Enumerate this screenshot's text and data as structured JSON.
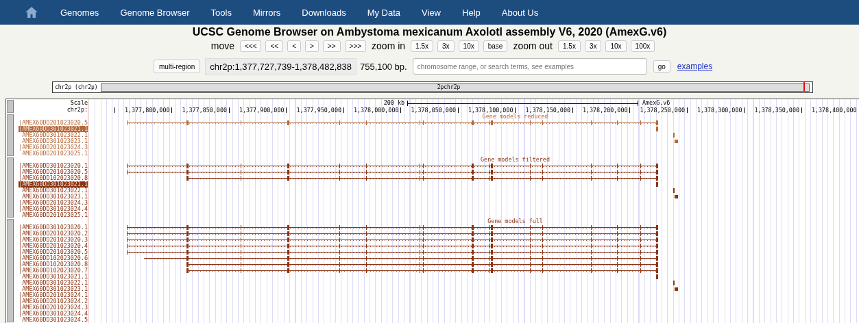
{
  "nav": [
    "Genomes",
    "Genome Browser",
    "Tools",
    "Mirrors",
    "Downloads",
    "My Data",
    "View",
    "Help",
    "About Us"
  ],
  "title": "UCSC Genome Browser on Ambystoma mexicanum Axolotl assembly V6, 2020 (AmexG.v6)",
  "move": {
    "label": "move",
    "buttons": [
      "<<<",
      "<<",
      "<",
      ">",
      ">>",
      ">>>"
    ]
  },
  "zoom_in": {
    "label": "zoom in",
    "buttons": [
      "1.5x",
      "3x",
      "10x",
      "base"
    ]
  },
  "zoom_out": {
    "label": "zoom out",
    "buttons": [
      "1.5x",
      "3x",
      "10x",
      "100x"
    ]
  },
  "position": {
    "multi_region": "multi-region",
    "value": "chr2p:1,377,727,739-1,378,482,838",
    "size": "755,100 bp.",
    "placeholder": "chromosome range, or search terms, see examples",
    "go": "go",
    "examples": "examples"
  },
  "ideogram": {
    "label": "chr2p (chr2p)",
    "band": "2pchr2p",
    "level": 0.992
  },
  "scale": {
    "label": "Scale",
    "chrom": "chr2p:",
    "bar_label": "200 kb",
    "assembly": "AmexG.v6",
    "ticks": [
      "1,377,800,000",
      "1,377,850,000",
      "1,377,900,000",
      "1,377,950,000",
      "1,378,000,000",
      "1,378,050,000",
      "1,378,100,000",
      "1,378,150,000",
      "1,378,200,000",
      "1,378,250,000",
      "1,378,300,000",
      "1,378,350,000",
      "1,378,400,000"
    ]
  },
  "tracks": [
    {
      "title": "Gene models reduced",
      "color": "#b5693a",
      "rows": [
        {
          "label": "|AMEX60DD201023020.5",
          "selected": false,
          "kind": "full"
        },
        {
          "label": "|AMEX60DD301023021.1",
          "selected": true,
          "kind": "end-mark"
        },
        {
          "label": "AMEX60DD301023022.1",
          "selected": false,
          "kind": "tick"
        },
        {
          "label": "AMEX60DD301023023.1",
          "selected": false,
          "kind": "block"
        },
        {
          "label": "|AMEX60DD201023024.3",
          "selected": false,
          "kind": "none"
        },
        {
          "label": "AMEX60DD201023025.1",
          "selected": false,
          "kind": "none"
        }
      ]
    },
    {
      "title": "Gene models filtered",
      "color": "#8a3414",
      "rows": [
        {
          "label": "|AMEX60DD301023020.1",
          "selected": false,
          "kind": "full"
        },
        {
          "label": "|AMEX60DD201023020.5",
          "selected": false,
          "kind": "full"
        },
        {
          "label": "|AMEX60DD102023020.8",
          "selected": false,
          "kind": "from-mid"
        },
        {
          "label": "|AMEX60DD301023021.1",
          "selected": true,
          "kind": "end-mark"
        },
        {
          "label": "AMEX60DD301023022.1",
          "selected": false,
          "kind": "tick"
        },
        {
          "label": "AMEX60DD301023023.1",
          "selected": false,
          "kind": "block"
        },
        {
          "label": "|AMEX60DD201023024.3",
          "selected": false,
          "kind": "none"
        },
        {
          "label": "|AMEX60DD301023024.4",
          "selected": false,
          "kind": "none"
        },
        {
          "label": "AMEX60DD201023025.1",
          "selected": false,
          "kind": "none"
        }
      ]
    },
    {
      "title": "Gene models full",
      "color": "#8a3414",
      "rows": [
        {
          "label": "|AMEX60DD301023020.1",
          "selected": false,
          "kind": "full"
        },
        {
          "label": "|AMEX60DD201023020.2",
          "selected": false,
          "kind": "full"
        },
        {
          "label": "|AMEX60DD201023020.3",
          "selected": false,
          "kind": "full"
        },
        {
          "label": "|AMEX60DD201023020.4",
          "selected": false,
          "kind": "full"
        },
        {
          "label": "|AMEX60DD201023020.5",
          "selected": false,
          "kind": "full"
        },
        {
          "label": "|AMEX60DD102023020.6",
          "selected": false,
          "kind": "from-early"
        },
        {
          "label": "|AMEX60DD102023020.8",
          "selected": false,
          "kind": "from-mid"
        },
        {
          "label": "|AMEX60DD102023020.7",
          "selected": false,
          "kind": "from-mid"
        },
        {
          "label": "AMEX60DD301023021.1",
          "selected": false,
          "kind": "end-mark"
        },
        {
          "label": "AMEX60DD301023022.1",
          "selected": false,
          "kind": "tick"
        },
        {
          "label": "AMEX60DD301023023.1",
          "selected": false,
          "kind": "block"
        },
        {
          "label": "|AMEX60DD201023024.1",
          "selected": false,
          "kind": "none"
        },
        {
          "label": "|AMEX60DD201023024.2",
          "selected": false,
          "kind": "none"
        },
        {
          "label": "|AMEX60DD201023024.3",
          "selected": false,
          "kind": "none"
        },
        {
          "label": "|AMEX60DD301023024.4",
          "selected": false,
          "kind": "none"
        },
        {
          "label": "AMEX60DD301023024.5",
          "selected": false,
          "kind": "none"
        }
      ]
    }
  ]
}
